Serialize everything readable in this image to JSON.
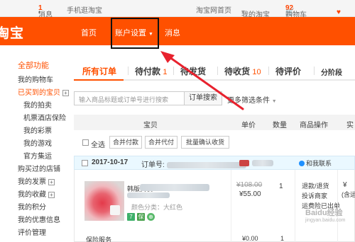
{
  "topbar": {
    "username": "          ",
    "messages_label": "消息",
    "messages_count": "1",
    "mobile_label": "手机逛淘宝",
    "home_label": "淘宝网首页",
    "my_taobao_label": "我的淘宝",
    "cart_label": "购物车",
    "cart_count": "92",
    "heart_icon": "heart-icon"
  },
  "header": {
    "logo": "淘宝",
    "nav": {
      "home": "首页",
      "account": "账户设置",
      "messages": "消息"
    }
  },
  "sidebar": {
    "title": "全部功能",
    "items": [
      "我的购物车",
      "已买到的宝贝",
      "我的拍卖",
      "机票酒店保险",
      "我的彩票",
      "我的游戏",
      "官方集运",
      "购买过的店铺",
      "我的发票",
      "我的收藏",
      "我的积分",
      "我的优惠信息",
      "评价管理"
    ],
    "plus_label": "+"
  },
  "tabs": {
    "all": "所有订单",
    "to_pay": "待付款",
    "to_pay_count": "1",
    "to_send": "待发货",
    "to_receive": "待收货",
    "to_receive_count": "10",
    "to_review": "待评价",
    "staged": "分阶段"
  },
  "search": {
    "placeholder": "输入商品标题或订单号进行搜索",
    "button": "订单搜索",
    "filter": "更多筛选条件"
  },
  "table_header": {
    "item": "宝贝",
    "price": "单价",
    "qty": "数量",
    "ops": "商品操作",
    "status": "实"
  },
  "batch": {
    "select_all": "全选",
    "merge_pay": "合并付款",
    "merge_proxy": "合并代付",
    "batch_confirm": "批量确认收货"
  },
  "order": {
    "date": "2017-10-17",
    "no_label": "订单号:",
    "contact": "和我联系",
    "item_desc_prefix": "韩版女装",
    "attr": "颜色分类：大红色",
    "badges": [
      "7",
      "保",
      "⊕"
    ],
    "price_old": "¥108.00",
    "price_new": "¥55.00",
    "qty": "1",
    "ops": [
      "退款/退货",
      "投诉商家",
      "运费险已出单"
    ],
    "status_price": "¥",
    "status_sub": "(含运",
    "service": "保险服务",
    "service_price": "¥0.00",
    "service_qty": "1"
  },
  "watermark": {
    "text": "Baidu经验",
    "sub": "jingyan.baidu.com"
  },
  "colors": {
    "brand": "#ff5000",
    "annotation": "#e8222e"
  }
}
